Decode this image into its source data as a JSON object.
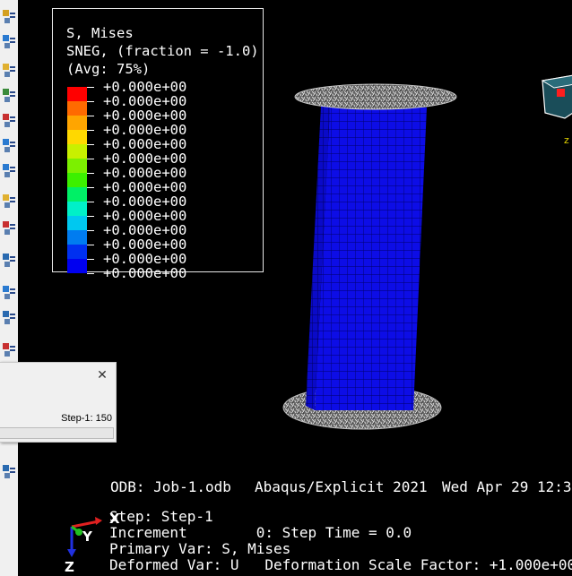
{
  "legend": {
    "title": "S, Mises",
    "subtitle": "SNEG, (fraction = -1.0)",
    "avg": "(Avg: 75%)",
    "colors": [
      "#ff0000",
      "#ff6a00",
      "#ffa500",
      "#ffd800",
      "#c8f000",
      "#7cf000",
      "#3cf000",
      "#00f066",
      "#00f0c8",
      "#00c8f0",
      "#007cf0",
      "#0030f0",
      "#0000f0"
    ],
    "values": [
      "+0.000e+00",
      "+0.000e+00",
      "+0.000e+00",
      "+0.000e+00",
      "+0.000e+00",
      "+0.000e+00",
      "+0.000e+00",
      "+0.000e+00",
      "+0.000e+00",
      "+0.000e+00",
      "+0.000e+00",
      "+0.000e+00",
      "+0.000e+00",
      "+0.000e+00"
    ]
  },
  "info": {
    "odb": "ODB: Job-1.odb",
    "solver": "Abaqus/Explicit 2021",
    "date": "Wed Apr 29 12:3",
    "step": "Step: Step-1",
    "increment": "Increment        0: Step Time = 0.0",
    "primary": "Primary Var: S, Mises",
    "deformed": "Deformed Var: U   Deformation Scale Factor: +1.000e+00"
  },
  "triad": {
    "x": "X",
    "y": "Y",
    "z": "Z"
  },
  "view_cube": {
    "axis_label": "z"
  },
  "progress_dialog": {
    "status": "Step-1: 150",
    "close_label": "✕"
  },
  "toolbar_icons": [
    "part-icon",
    "mesh-grid-icon",
    "assembly-icon",
    "step-icon",
    "interaction-icon",
    "load-icon",
    "field-output-icon",
    "history-output-icon",
    "stress-plot-icon",
    "table-icon",
    "xy-data-icon",
    "report-icon",
    "xy-plot-icon",
    "animation-icon",
    "table-icon",
    "table-icon"
  ]
}
